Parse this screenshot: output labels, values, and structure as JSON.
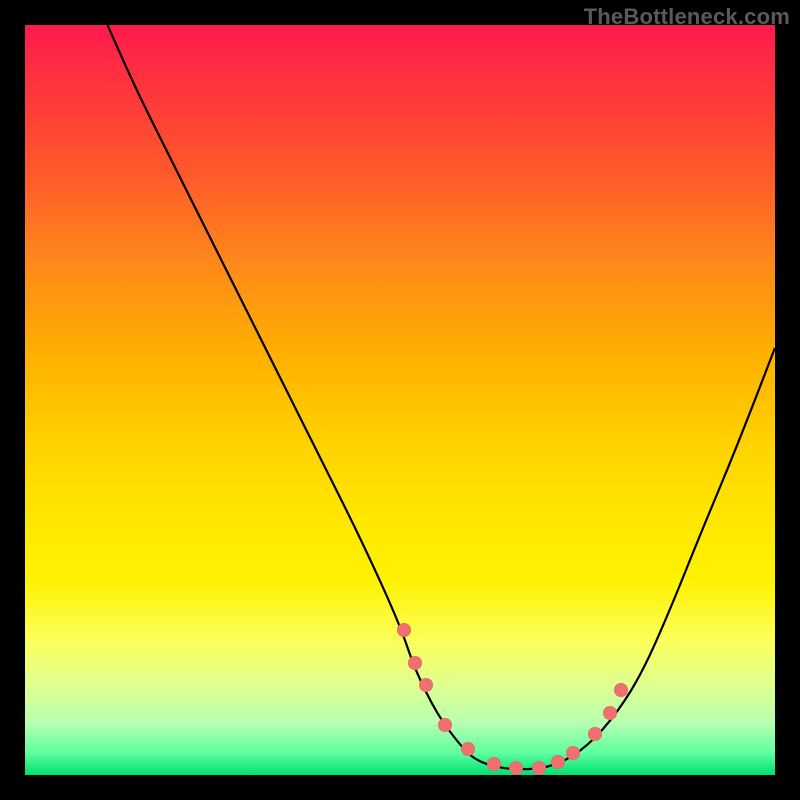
{
  "watermark": "TheBottleneck.com",
  "chart_data": {
    "type": "line",
    "title": "",
    "xlabel": "",
    "ylabel": "",
    "xlim": [
      0,
      100
    ],
    "ylim": [
      0,
      100
    ],
    "series": [
      {
        "name": "curve",
        "x": [
          11,
          15,
          20,
          25,
          30,
          35,
          40,
          45,
          50,
          52,
          55,
          58,
          60,
          63,
          66,
          70,
          74,
          78,
          82,
          86,
          90,
          95,
          100
        ],
        "values": [
          100,
          91,
          81,
          71,
          61,
          51,
          41,
          31,
          20,
          14,
          8,
          4,
          2,
          1,
          0.7,
          1,
          3,
          7,
          13,
          22,
          32,
          44,
          57
        ]
      }
    ],
    "dots": {
      "name": "highlight-dots",
      "color": "#f07070",
      "x": [
        50.5,
        52.0,
        53.5,
        56.0,
        59.0,
        62.5,
        65.5,
        68.5,
        71.0,
        73.0,
        76.0,
        78.0,
        79.5
      ],
      "values": [
        19.3,
        15.0,
        12.0,
        6.7,
        3.5,
        1.5,
        0.9,
        1.0,
        1.7,
        3.0,
        5.5,
        8.3,
        11.3
      ]
    },
    "gradient_stops": [
      {
        "pct": 0,
        "color": "#ff1a4d"
      },
      {
        "pct": 10,
        "color": "#ff3a3a"
      },
      {
        "pct": 20,
        "color": "#ff5a2a"
      },
      {
        "pct": 32,
        "color": "#ff8a1a"
      },
      {
        "pct": 44,
        "color": "#ffb000"
      },
      {
        "pct": 55,
        "color": "#ffd000"
      },
      {
        "pct": 65,
        "color": "#ffe600"
      },
      {
        "pct": 74,
        "color": "#fff200"
      },
      {
        "pct": 82,
        "color": "#fbff5a"
      },
      {
        "pct": 88,
        "color": "#e0ff90"
      },
      {
        "pct": 93,
        "color": "#b8ffb0"
      },
      {
        "pct": 97,
        "color": "#60ffa0"
      },
      {
        "pct": 100,
        "color": "#00e070"
      }
    ]
  }
}
